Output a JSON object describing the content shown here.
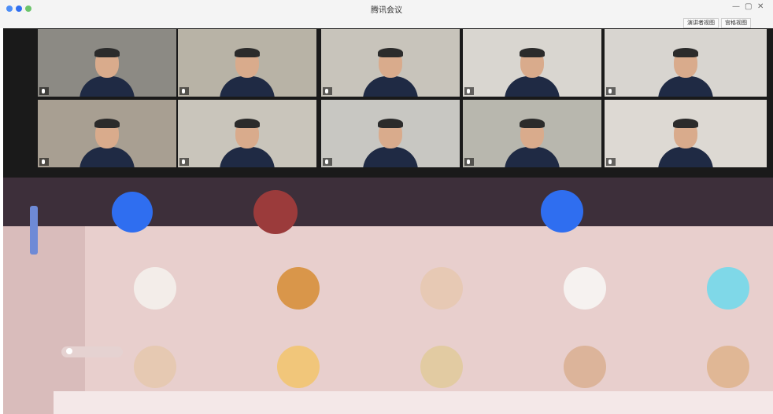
{
  "window": {
    "title": "腾讯会议"
  },
  "toolbar": {
    "view_label": "演讲者视图",
    "layout_label": "宫格视图"
  },
  "video_tiles": [
    {
      "name": "",
      "bg": "#8c8a84"
    },
    {
      "name": "",
      "bg": "#b8b3a6"
    },
    {
      "name": "",
      "bg": "#c8c4bb"
    },
    {
      "name": "",
      "bg": "#d9d6d0"
    },
    {
      "name": "",
      "bg": "#d8d5d0"
    },
    {
      "name": "",
      "bg": "#a89f92"
    },
    {
      "name": "",
      "bg": "#c9c5bb"
    },
    {
      "name": "",
      "bg": "#c8c7c2"
    },
    {
      "name": "",
      "bg": "#b8b7ae"
    },
    {
      "name": "",
      "bg": "#ddd9d3"
    }
  ],
  "gallery_avatars": [
    {
      "name": "",
      "color": "#f3ede9"
    },
    {
      "name": "",
      "color": "#d9964a"
    },
    {
      "name": "",
      "color": "#e7c9b4"
    },
    {
      "name": "",
      "color": "#f6f2f0"
    },
    {
      "name": "",
      "color": "#7fd8e8"
    },
    {
      "name": "",
      "color": "#e6c9b2"
    },
    {
      "name": "",
      "color": "#f1c67a"
    },
    {
      "name": "",
      "color": "#e2cba2"
    },
    {
      "name": "",
      "color": "#dcb49a"
    },
    {
      "name": "",
      "color": "#e0b795"
    }
  ],
  "top_avatar": {
    "label": "",
    "color": "#2f6ef0"
  },
  "chat": {
    "label": ""
  }
}
